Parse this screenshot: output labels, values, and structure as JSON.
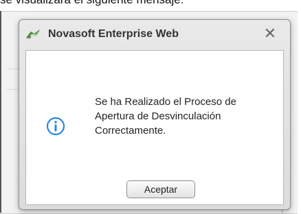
{
  "background": {
    "caption": "se visualizara el siguiente mensaje:"
  },
  "dialog": {
    "title": "Novasoft Enterprise Web",
    "app_icon": "novasoft-logo-icon",
    "close_glyph": "✕",
    "message_icon": "info-icon",
    "message": "Se ha Realizado el Proceso de\nApertura de Desvinculación\nCorrectamente.",
    "ok_label": "Aceptar"
  },
  "colors": {
    "info_icon": "#2b86d9",
    "logo_green": "#3e8a2e"
  }
}
